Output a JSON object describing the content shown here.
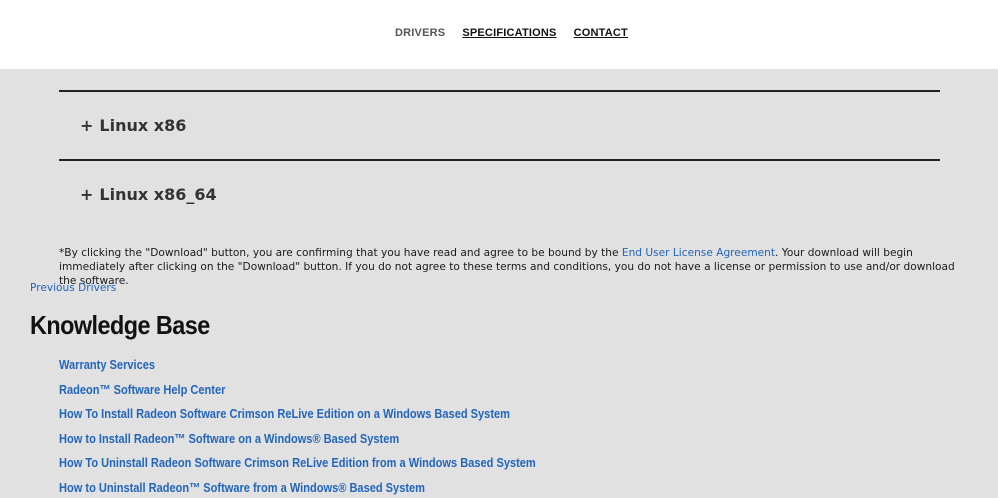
{
  "nav": {
    "drivers": "DRIVERS",
    "specifications": "SPECIFICATIONS",
    "contact": "CONTACT"
  },
  "accordion": [
    {
      "icon": "plus-icon",
      "label": "Linux x86"
    },
    {
      "icon": "plus-icon",
      "label": "Linux x86_64"
    }
  ],
  "disclaimer": {
    "before": "*By clicking the \"Download\" button, you are confirming that you have read and agree to be bound by the ",
    "link": "End User License Agreement",
    "after": ". Your download will begin immediately after clicking on the \"Download\" button. If you do not agree to these terms and conditions, you do not have a license or permission to use and/or download the software."
  },
  "previous_drivers": "Previous Drivers",
  "knowledge_base": {
    "title": "Knowledge Base",
    "links": [
      "Warranty Services",
      "Radeon™ Software Help Center",
      "How To Install Radeon Software Crimson ReLive Edition on a Windows Based System",
      "How to Install Radeon™ Software on a Windows® Based System",
      "How To Uninstall Radeon Software Crimson ReLive Edition from a Windows Based System",
      "How to Uninstall Radeon™ Software from a Windows® Based System"
    ]
  },
  "colors": {
    "link": "#2266bb",
    "background": "#e1e1e1",
    "header": "#ffffff"
  }
}
